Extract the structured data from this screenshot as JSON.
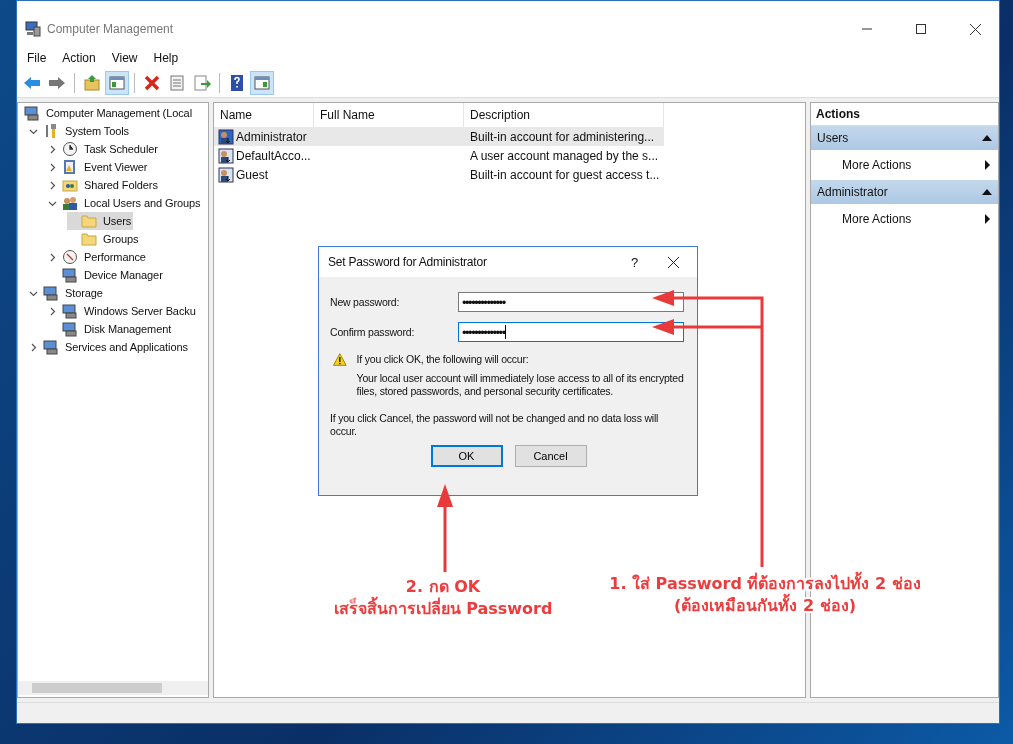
{
  "window": {
    "title": "Computer Management"
  },
  "menu": [
    "File",
    "Action",
    "View",
    "Help"
  ],
  "toolbar": [
    {
      "kind": "back",
      "pressed": false
    },
    {
      "kind": "forward",
      "pressed": false
    },
    {
      "kind": "up",
      "pressed": false
    },
    {
      "kind": "tree",
      "pressed": true
    },
    {
      "kind": "delete",
      "pressed": false
    },
    {
      "kind": "properties",
      "pressed": false
    },
    {
      "kind": "export",
      "pressed": false
    },
    {
      "kind": "help",
      "pressed": false
    },
    {
      "kind": "actionpane",
      "pressed": true
    }
  ],
  "tree": [
    {
      "label": "Computer Management (Local",
      "selected": false,
      "children": [
        {
          "label": "System Tools",
          "expanded": true,
          "selected": false,
          "children": [
            {
              "label": "Task Scheduler",
              "expanded": false,
              "selected": false
            },
            {
              "label": "Event Viewer",
              "expanded": false,
              "selected": false
            },
            {
              "label": "Shared Folders",
              "expanded": false,
              "selected": false
            },
            {
              "label": "Local Users and Groups",
              "expanded": true,
              "selected": false,
              "children": [
                {
                  "label": "Users",
                  "selected": true
                },
                {
                  "label": "Groups",
                  "selected": false
                }
              ]
            },
            {
              "label": "Performance",
              "expanded": false,
              "selected": false
            },
            {
              "label": "Device Manager",
              "selected": false
            }
          ]
        },
        {
          "label": "Storage",
          "expanded": true,
          "selected": false,
          "children": [
            {
              "label": "Windows Server Backu",
              "expanded": false,
              "selected": false
            },
            {
              "label": "Disk Management",
              "selected": false
            }
          ]
        },
        {
          "label": "Services and Applications",
          "expanded": false,
          "selected": false
        }
      ]
    }
  ],
  "table": {
    "columns": [
      "Name",
      "Full Name",
      "Description"
    ],
    "rows": [
      {
        "name": "Administrator",
        "full_name": "",
        "description": "Built-in account for administering...",
        "selected": true
      },
      {
        "name": "DefaultAcco...",
        "full_name": "",
        "description": "A user account managed by the s...",
        "selected": false
      },
      {
        "name": "Guest",
        "full_name": "",
        "description": "Built-in account for guest access t...",
        "selected": false
      }
    ]
  },
  "actions": {
    "title": "Actions",
    "sections": [
      {
        "title": "Users",
        "expanded": true,
        "items": [
          "More Actions"
        ]
      },
      {
        "title": "Administrator",
        "expanded": true,
        "items": [
          "More Actions"
        ]
      }
    ]
  },
  "dialog": {
    "title": "Set Password for Administrator",
    "help": "?",
    "fields": [
      {
        "label": "New password:",
        "value": "••••••••••••••",
        "focused": false
      },
      {
        "label": "Confirm password:",
        "value": "••••••••••••••",
        "focused": true
      }
    ],
    "warning_title": "If you click OK, the following will occur:",
    "warning_text": "Your local user account will immediately lose access to all of its encrypted files, stored passwords, and personal security certificates.",
    "cancel_note": "If you click Cancel, the password will not be changed and no data loss will occur.",
    "buttons": [
      {
        "label": "OK",
        "default": true
      },
      {
        "label": "Cancel",
        "default": false
      }
    ]
  },
  "annotations": [
    {
      "lines": [
        "2. กด OK",
        "เสร็จสิ้นการเปลี่ยน Password"
      ]
    },
    {
      "lines": [
        "1. ใส่ Password ที่ต้องการลงไปทั้ง 2 ช่อง",
        "(ต้องเหมือนกันทั้ง 2 ช่อง)"
      ]
    }
  ]
}
